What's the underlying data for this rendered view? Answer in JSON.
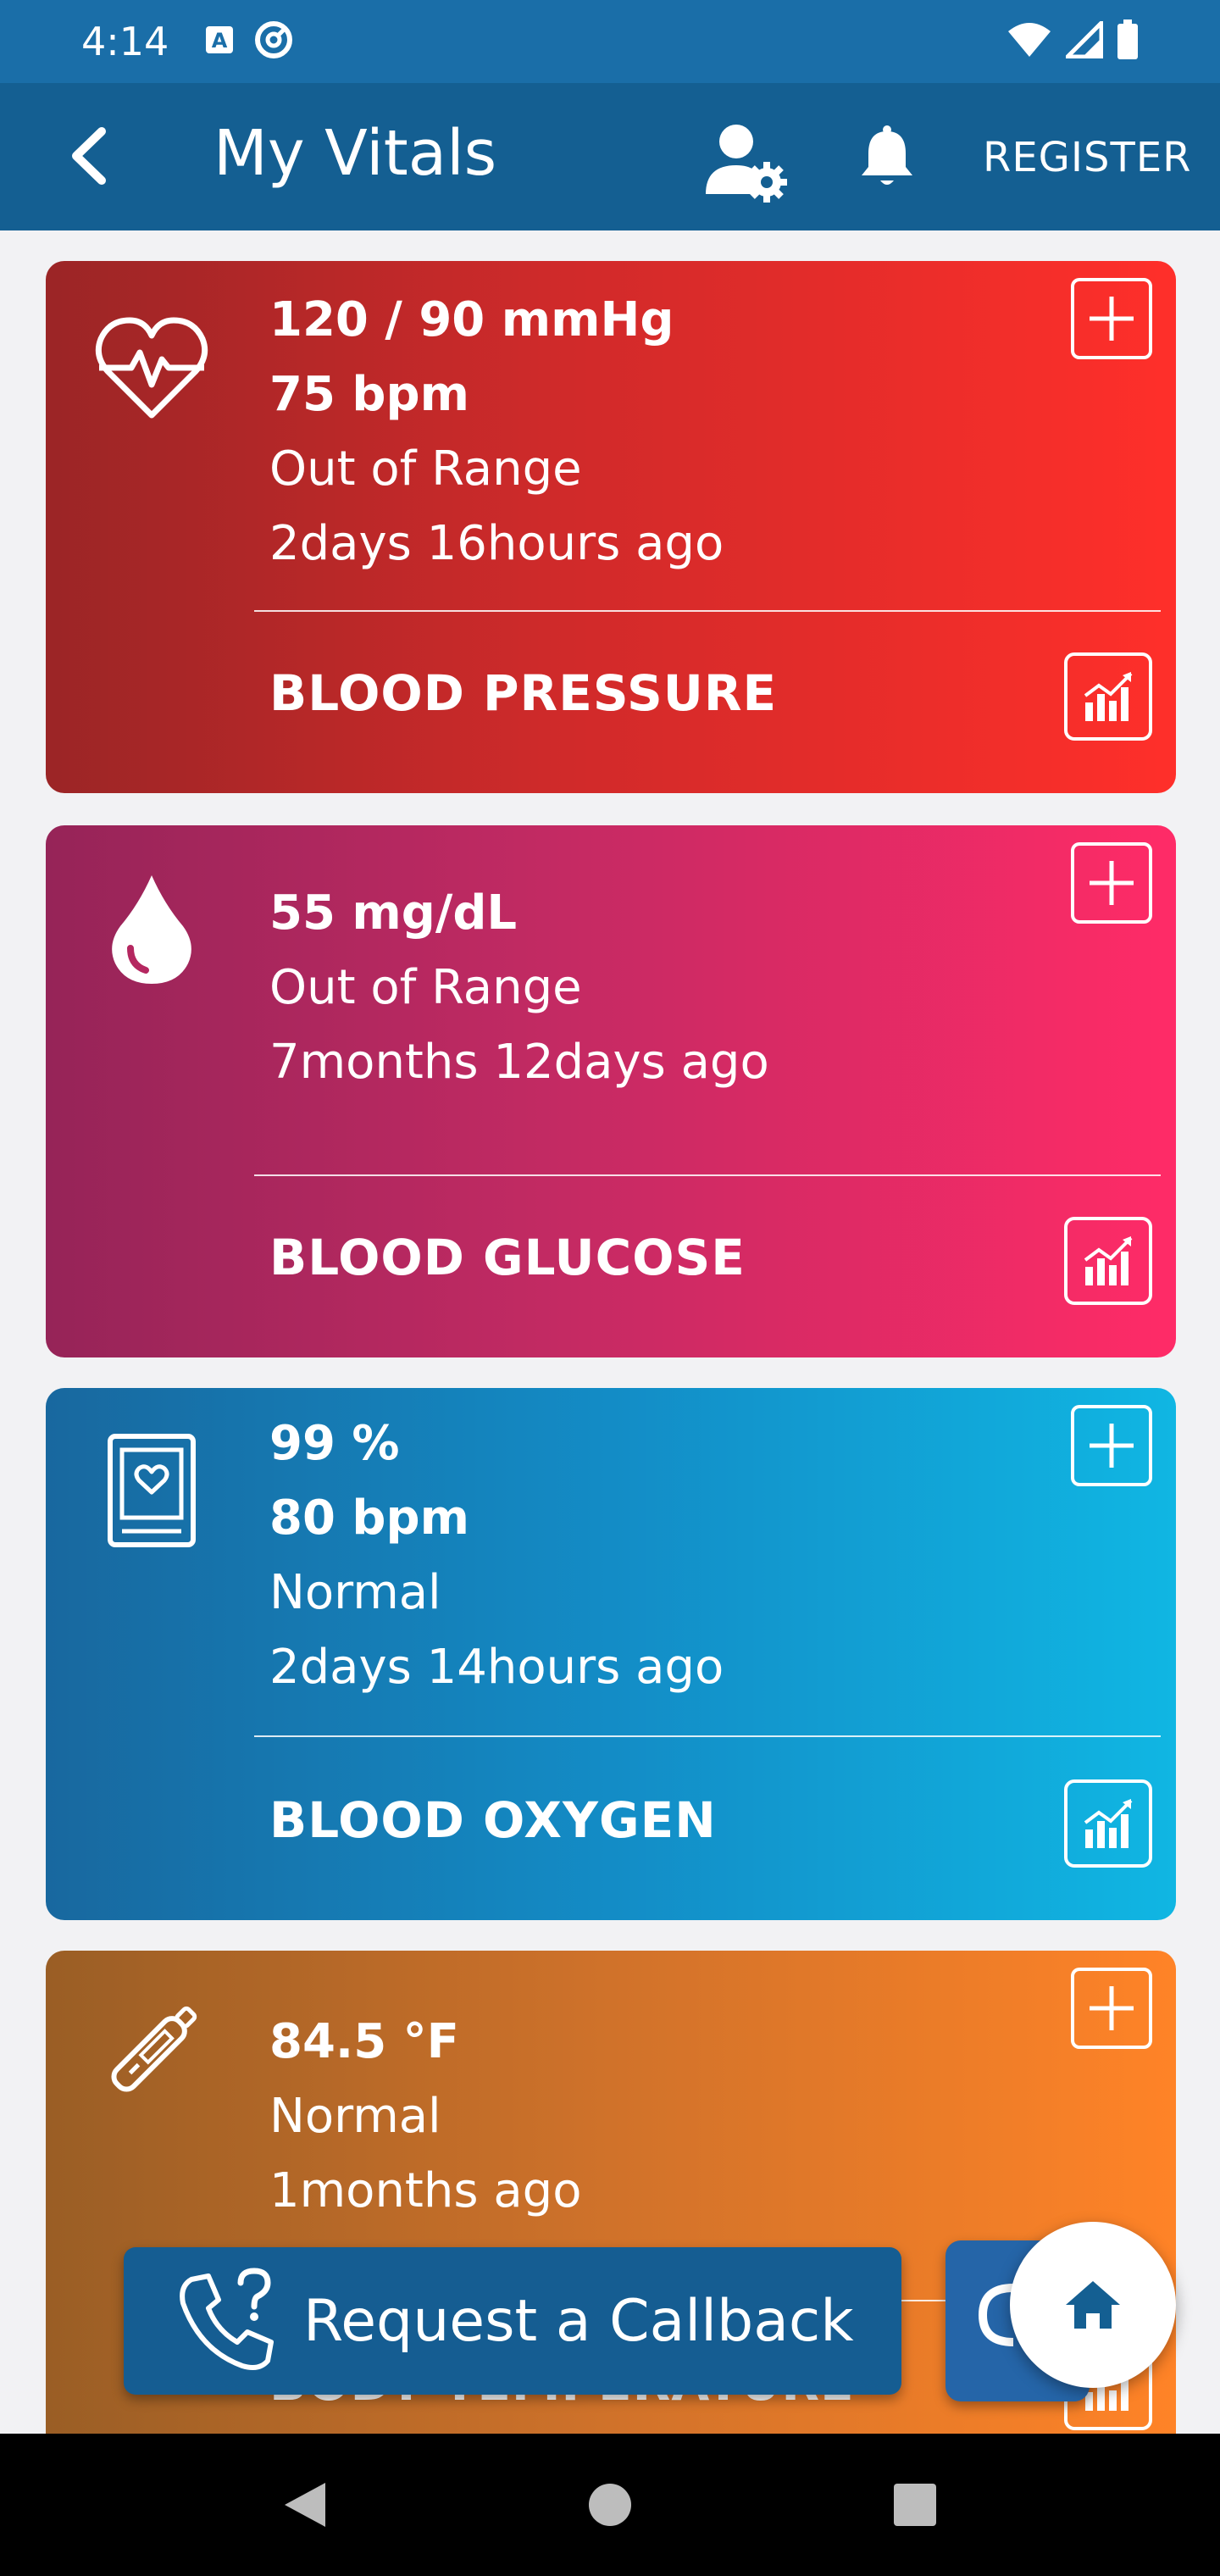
{
  "status_bar": {
    "time": "4:14",
    "icons": [
      "a-badge-icon",
      "do-not-disturb-icon",
      "wifi-icon",
      "cell-signal-icon",
      "battery-icon"
    ]
  },
  "app_bar": {
    "title": "My Vitals",
    "register_label": "REGISTER",
    "icons": [
      "back-arrow-icon",
      "user-settings-icon",
      "bell-icon"
    ]
  },
  "cards": [
    {
      "name": "BLOOD PRESSURE",
      "icon": "heart-pulse-icon",
      "lines": [
        "120 / 90 mmHg",
        "75 bpm",
        "Out of Range",
        "2days 16hours ago"
      ],
      "color": "#d42b2a"
    },
    {
      "name": "BLOOD GLUCOSE",
      "icon": "drop-icon",
      "lines": [
        "55 mg/dL",
        "Out of Range",
        "7months 12days ago"
      ],
      "color": "#cf2b63"
    },
    {
      "name": "BLOOD OXYGEN",
      "icon": "oximeter-icon",
      "lines": [
        "99 %",
        "80 bpm",
        "Normal",
        "2days 14hours ago"
      ],
      "color": "#138cc6"
    },
    {
      "name": "BODY TEMPERATURE",
      "icon": "thermometer-icon",
      "lines": [
        "84.5 °F",
        "Normal",
        "1months ago"
      ],
      "color": "#d0722a"
    }
  ],
  "callback": {
    "label": "Request a Callback"
  },
  "nav": [
    "back-triangle-icon",
    "home-circle-icon",
    "recents-square-icon"
  ]
}
